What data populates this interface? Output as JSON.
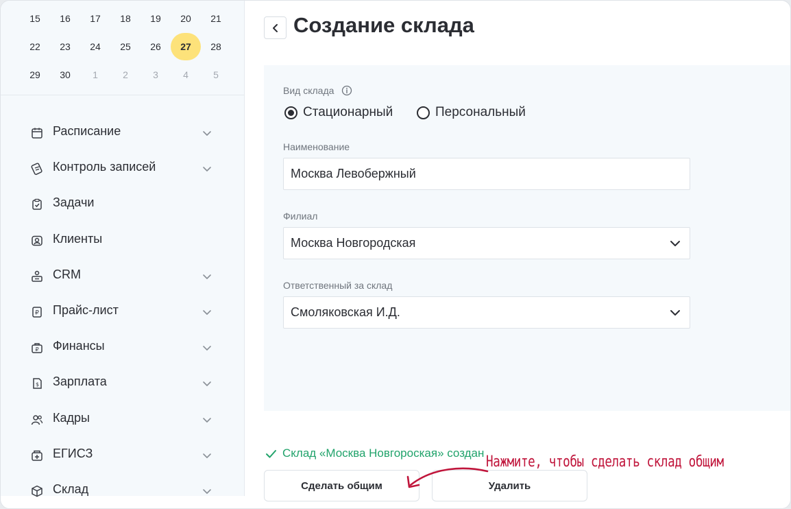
{
  "calendar": {
    "rows": [
      [
        {
          "d": "15"
        },
        {
          "d": "16"
        },
        {
          "d": "17"
        },
        {
          "d": "18"
        },
        {
          "d": "19"
        },
        {
          "d": "20"
        },
        {
          "d": "21"
        }
      ],
      [
        {
          "d": "22"
        },
        {
          "d": "23"
        },
        {
          "d": "24"
        },
        {
          "d": "25"
        },
        {
          "d": "26"
        },
        {
          "d": "27",
          "today": true
        },
        {
          "d": "28"
        }
      ],
      [
        {
          "d": "29"
        },
        {
          "d": "30"
        },
        {
          "d": "1",
          "muted": true
        },
        {
          "d": "2",
          "muted": true
        },
        {
          "d": "3",
          "muted": true
        },
        {
          "d": "4",
          "muted": true
        },
        {
          "d": "5",
          "muted": true
        }
      ]
    ]
  },
  "sidebar": {
    "items": [
      {
        "label": "Расписание",
        "icon": "calendar-icon",
        "expandable": true
      },
      {
        "label": "Контроль записей",
        "icon": "records-control-icon",
        "expandable": true
      },
      {
        "label": "Задачи",
        "icon": "tasks-icon",
        "expandable": false
      },
      {
        "label": "Клиенты",
        "icon": "clients-icon",
        "expandable": false
      },
      {
        "label": "CRM",
        "icon": "crm-icon",
        "expandable": true
      },
      {
        "label": "Прайс-лист",
        "icon": "price-list-icon",
        "expandable": true
      },
      {
        "label": "Финансы",
        "icon": "finance-icon",
        "expandable": true
      },
      {
        "label": "Зарплата",
        "icon": "salary-icon",
        "expandable": true
      },
      {
        "label": "Кадры",
        "icon": "staff-icon",
        "expandable": true
      },
      {
        "label": "ЕГИСЗ",
        "icon": "egisz-icon",
        "expandable": true
      },
      {
        "label": "Склад",
        "icon": "warehouse-icon",
        "expandable": true
      }
    ]
  },
  "header": {
    "title": "Создание склада"
  },
  "form": {
    "type_label": "Вид склада",
    "type_options": [
      {
        "label": "Стационарный",
        "checked": true
      },
      {
        "label": "Персональный",
        "checked": false
      }
    ],
    "name_label": "Наименование",
    "name_value": "Москва Левобержный",
    "branch_label": "Филиал",
    "branch_value": "Москва Новгородская",
    "responsible_label": "Ответственный за склад",
    "responsible_value": "Смоляковская И.Д."
  },
  "status": {
    "success_text": "Склад «Москва Новгороская» создан",
    "success_color": "#21a36b"
  },
  "actions": {
    "make_shared_label": "Сделать общим",
    "delete_label": "Удалить"
  },
  "annotation": {
    "hint_text": "Нажмите, чтобы сделать склад общим",
    "hint_color": "#c0153b"
  }
}
